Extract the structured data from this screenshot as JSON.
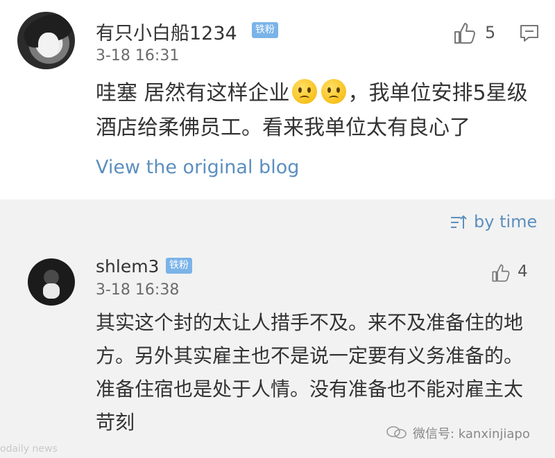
{
  "comment1": {
    "username": "有只小白船1234",
    "badge": "铁粉",
    "time": "3-18 16:31",
    "likes": "5",
    "text_part1": "哇塞 居然有这样企业",
    "text_part2": "，我单位安排5星级酒店给柔佛员工。看来我单位太有良心了",
    "view_link": "View the original blog"
  },
  "sort": {
    "label": "by time"
  },
  "comment2": {
    "username": "shlem3",
    "badge": "铁粉",
    "time": "3-18 16:38",
    "likes": "4",
    "text": "其实这个封的太让人措手不及。来不及准备住的地方。另外其实雇主也不是说一定要有义务准备的。准备住宿也是处于人情。没有准备也不能对雇主太苛刻"
  },
  "watermark": {
    "text": "微信号: kanxinjiapo"
  },
  "faint_text": "odaily news",
  "colors": {
    "link": "#5b8fbf",
    "badge": "#7ab3e8",
    "section_bg": "#f2f2f2"
  },
  "icons": [
    "thumbs-up-icon",
    "reply-icon",
    "sort-icon",
    "wechat-icon",
    "sad-face-emoji"
  ]
}
